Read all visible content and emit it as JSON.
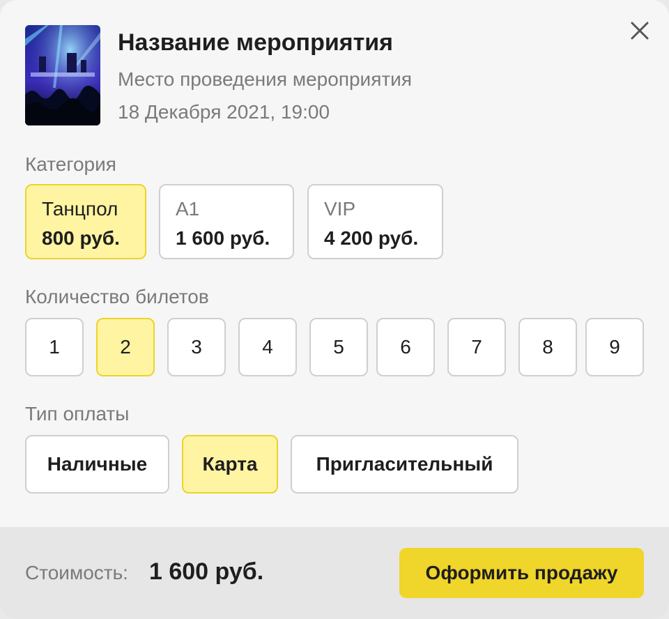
{
  "event": {
    "title": "Название мероприятия",
    "venue": "Место проведения мероприятия",
    "date": "18 Декабря 2021, 19:00"
  },
  "icons": {
    "close": "close-icon",
    "thumbnail": "event-photo"
  },
  "category": {
    "label": "Категория",
    "options": [
      {
        "name": "Танцпол",
        "price": "800 руб.",
        "selected": true
      },
      {
        "name": "A1",
        "price": "1 600 руб.",
        "selected": false
      },
      {
        "name": "VIP",
        "price": "4 200 руб.",
        "selected": false
      }
    ]
  },
  "quantity": {
    "label": "Количество билетов",
    "options": [
      "1",
      "2",
      "3",
      "4",
      "5",
      "6",
      "7",
      "8",
      "9"
    ],
    "selected": "2"
  },
  "payment": {
    "label": "Тип оплаты",
    "options": [
      "Наличные",
      "Карта",
      "Пригласительный"
    ],
    "selected": "Карта"
  },
  "footer": {
    "cost_label": "Стоимость:",
    "cost_value": "1 600 руб.",
    "submit_label": "Оформить продажу"
  },
  "colors": {
    "accent": "#f0d52a",
    "selected_fill": "#fef4a2",
    "selected_border": "#ecd32a",
    "muted_text": "#7a7a7a"
  }
}
